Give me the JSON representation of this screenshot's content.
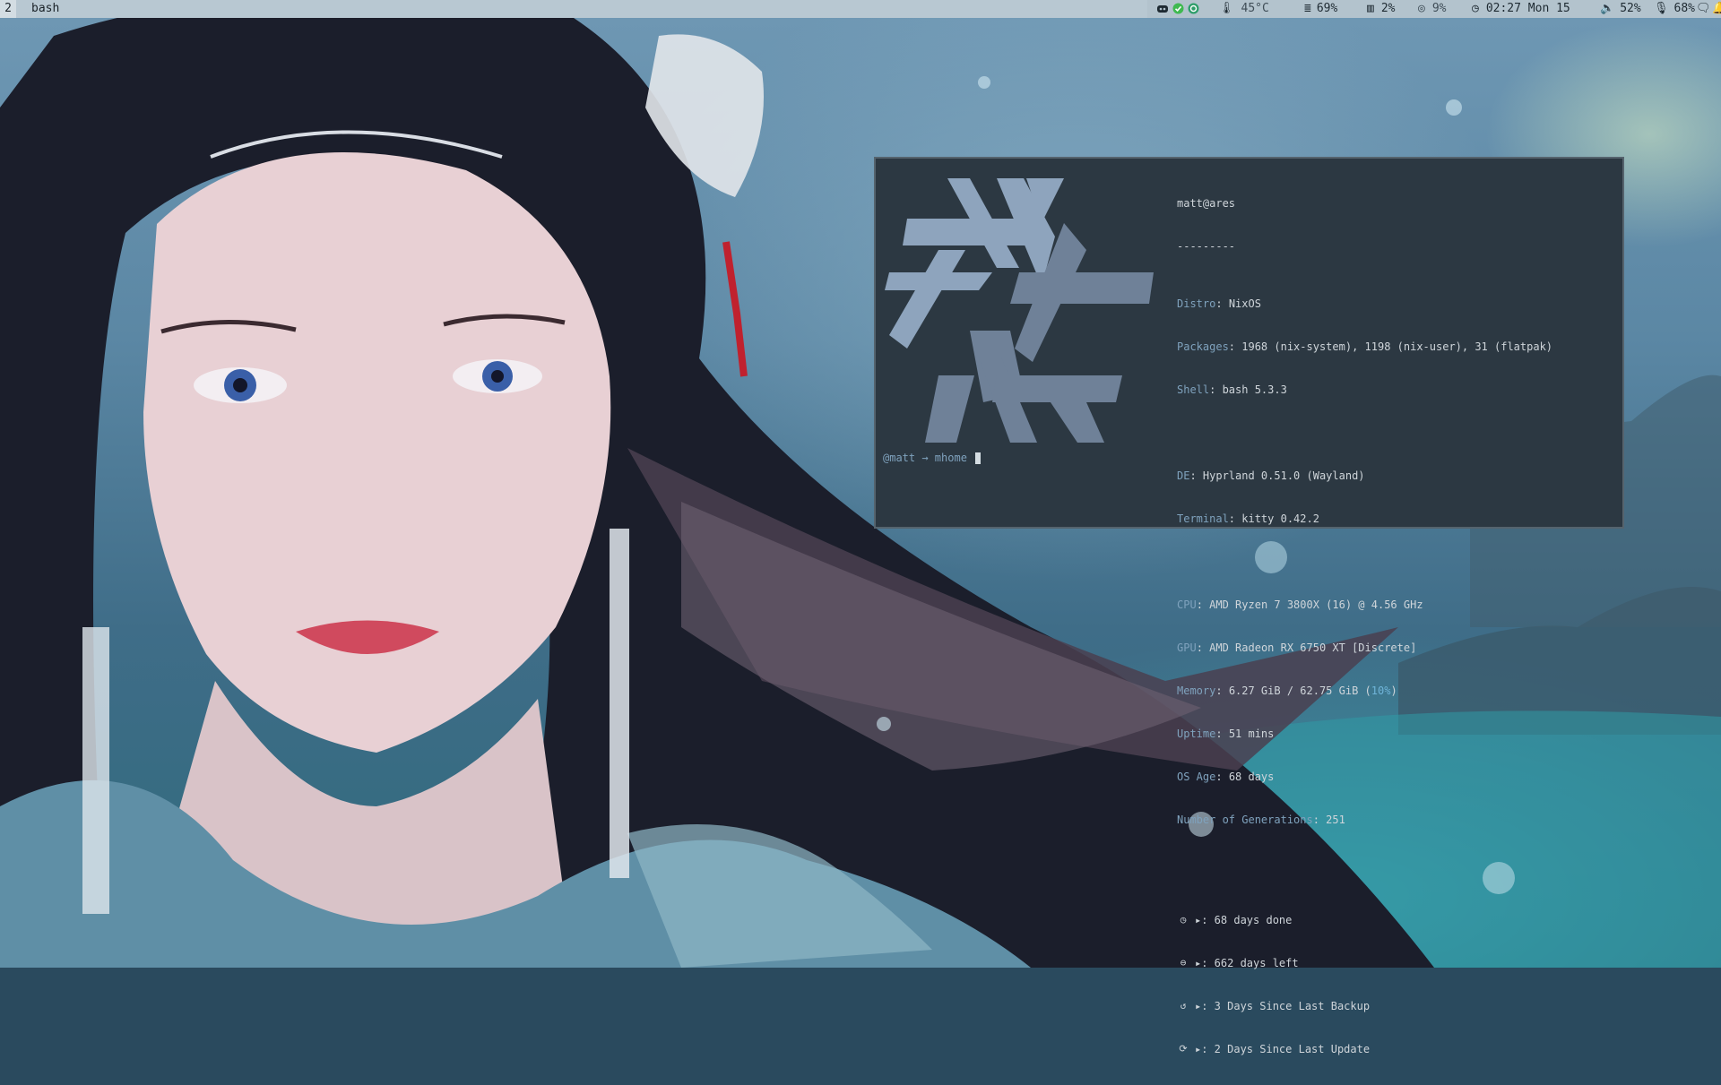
{
  "colors": {
    "bar_bg": "#b8c8d2",
    "terminal_bg": "#2c3842",
    "key_color": "#7fa2bd",
    "value_color": "#cfd5da",
    "accent": "#6fb4d8"
  },
  "topbar": {
    "workspace": "2",
    "window_title": "bash",
    "tray": {
      "apps": [
        "discord-icon",
        "check-icon",
        "sync-icon"
      ],
      "temperature": "45°C",
      "memory": "69%",
      "cpu": "2%",
      "disk": "9%",
      "clock": "02:27 Mon 15",
      "volume": "52%",
      "mic": "68%"
    }
  },
  "terminal": {
    "userhost": "matt@ares",
    "separator": "---------",
    "info": [
      {
        "key": "Distro",
        "value": "NixOS"
      },
      {
        "key": "Packages",
        "value": "1968 (nix-system), 1198 (nix-user), 31 (flatpak)"
      },
      {
        "key": "Shell",
        "value": "bash 5.3.3"
      },
      {
        "key": "DE",
        "value": "Hyprland 0.51.0 (Wayland)"
      },
      {
        "key": "Terminal",
        "value": "kitty 0.42.2"
      },
      {
        "key": "CPU",
        "value": "AMD Ryzen 7 3800X (16) @ 4.56 GHz"
      },
      {
        "key": "GPU",
        "value": "AMD Radeon RX 6750 XT [Discrete]"
      },
      {
        "key": "Memory",
        "value_pre": "6.27 GiB / 62.75 GiB (",
        "value_pct": "10%",
        "value_post": ")"
      },
      {
        "key": "Uptime",
        "value": "51 mins"
      },
      {
        "key": "OS Age",
        "value": "68 days"
      },
      {
        "key": "Number of Generations",
        "value": "251"
      }
    ],
    "timeline": [
      {
        "icon": "clock-icon",
        "text": "▸: 68 days done"
      },
      {
        "icon": "circle-icon",
        "text": "▸: 662 days left"
      },
      {
        "icon": "history-icon",
        "text": "▸: 3 Days Since Last Backup"
      },
      {
        "icon": "refresh-icon",
        "text": "▸: 2 Days Since Last Update"
      }
    ],
    "prompt": "@matt → mhome "
  }
}
